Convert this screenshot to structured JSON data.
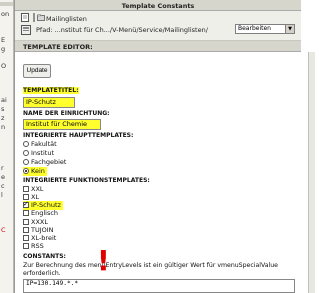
{
  "sidebar": {
    "fragments": [
      "on",
      "E",
      "g",
      "O",
      "ai",
      "s",
      "z",
      "n",
      "r",
      "e",
      "c",
      "l"
    ],
    "red_fragment": "C"
  },
  "header": {
    "title": "Template Constants"
  },
  "toolbar": {
    "breadcrumb_item": "Mailinglisten",
    "path": "Pfad: ...nstitut für Ch.../V-Menü/Service/Mailinglisten/",
    "mode_select": {
      "value": "Bearbeiten"
    }
  },
  "editor": {
    "title": "TEMPLATE EDITOR:",
    "update_label": "Update",
    "templatetitel_label": "TEMPLATETITEL:",
    "templatetitel_value": "IP-Schutz",
    "einrichtung_label": "NAME DER EINRICHTUNG:",
    "einrichtung_value": "Institut für Chemie",
    "haupt_label": "INTEGRIERTE HAUPTTEMPLATES:",
    "haupt_options": [
      {
        "label": "Fakultät",
        "selected": false
      },
      {
        "label": "Institut",
        "selected": false
      },
      {
        "label": "Fachgebiet",
        "selected": false
      },
      {
        "label": "Kein",
        "selected": true
      }
    ],
    "funktion_label": "INTEGRIERTE FUNKTIONSTEMPLATES:",
    "funktion_options": [
      {
        "label": "XXL",
        "checked": false
      },
      {
        "label": "XL",
        "checked": false
      },
      {
        "label": "IP-Schutz",
        "checked": true
      },
      {
        "label": "Englisch",
        "checked": false
      },
      {
        "label": "XXXL",
        "checked": false
      },
      {
        "label": "TUJOIN",
        "checked": false
      },
      {
        "label": "XL-breit",
        "checked": false
      },
      {
        "label": "RSS",
        "checked": false
      }
    ],
    "constants_label": "CONSTANTS:",
    "constants_description": "Zur Berechnung des menuEntryLevels ist ein gültiger Wert für vmenuSpecialValue erforderlich.",
    "constants_value": "IP=130.149.*.*",
    "exclamation": "!"
  },
  "colors": {
    "highlight": "#ffff2e",
    "header_bg": "#d6d6cc",
    "alert_red": "#e10000"
  }
}
